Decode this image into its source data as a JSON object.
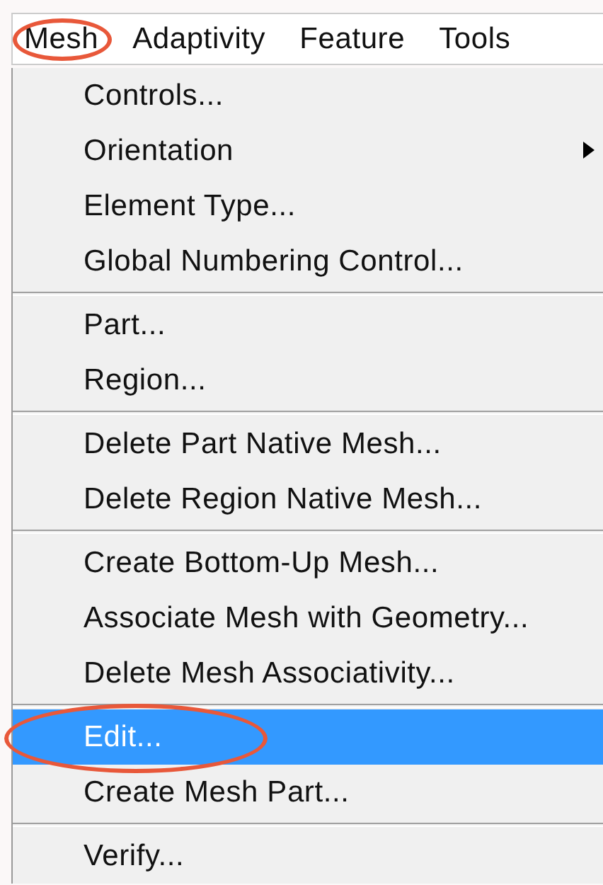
{
  "menubar": [
    {
      "label": "Mesh",
      "circled": true
    },
    {
      "label": "Adaptivity",
      "circled": false
    },
    {
      "label": "Feature",
      "circled": false
    },
    {
      "label": "Tools",
      "circled": false
    }
  ],
  "menu": {
    "items": [
      {
        "kind": "item",
        "label": "Controls...",
        "submenu": false,
        "selected": false,
        "circled": false
      },
      {
        "kind": "item",
        "label": "Orientation",
        "submenu": true,
        "selected": false,
        "circled": false
      },
      {
        "kind": "item",
        "label": "Element Type...",
        "submenu": false,
        "selected": false,
        "circled": false
      },
      {
        "kind": "item",
        "label": "Global Numbering Control...",
        "submenu": false,
        "selected": false,
        "circled": false
      },
      {
        "kind": "separator"
      },
      {
        "kind": "item",
        "label": "Part...",
        "submenu": false,
        "selected": false,
        "circled": false
      },
      {
        "kind": "item",
        "label": "Region...",
        "submenu": false,
        "selected": false,
        "circled": false
      },
      {
        "kind": "separator"
      },
      {
        "kind": "item",
        "label": "Delete Part Native Mesh...",
        "submenu": false,
        "selected": false,
        "circled": false
      },
      {
        "kind": "item",
        "label": "Delete Region Native Mesh...",
        "submenu": false,
        "selected": false,
        "circled": false
      },
      {
        "kind": "separator"
      },
      {
        "kind": "item",
        "label": "Create Bottom-Up Mesh...",
        "submenu": false,
        "selected": false,
        "circled": false
      },
      {
        "kind": "item",
        "label": "Associate Mesh with Geometry...",
        "submenu": false,
        "selected": false,
        "circled": false
      },
      {
        "kind": "item",
        "label": "Delete Mesh Associativity...",
        "submenu": false,
        "selected": false,
        "circled": false
      },
      {
        "kind": "separator"
      },
      {
        "kind": "item",
        "label": "Edit...",
        "submenu": false,
        "selected": true,
        "circled": true
      },
      {
        "kind": "item",
        "label": "Create Mesh Part...",
        "submenu": false,
        "selected": false,
        "circled": false
      },
      {
        "kind": "separator"
      },
      {
        "kind": "item",
        "label": "Verify...",
        "submenu": false,
        "selected": false,
        "circled": false
      }
    ]
  }
}
